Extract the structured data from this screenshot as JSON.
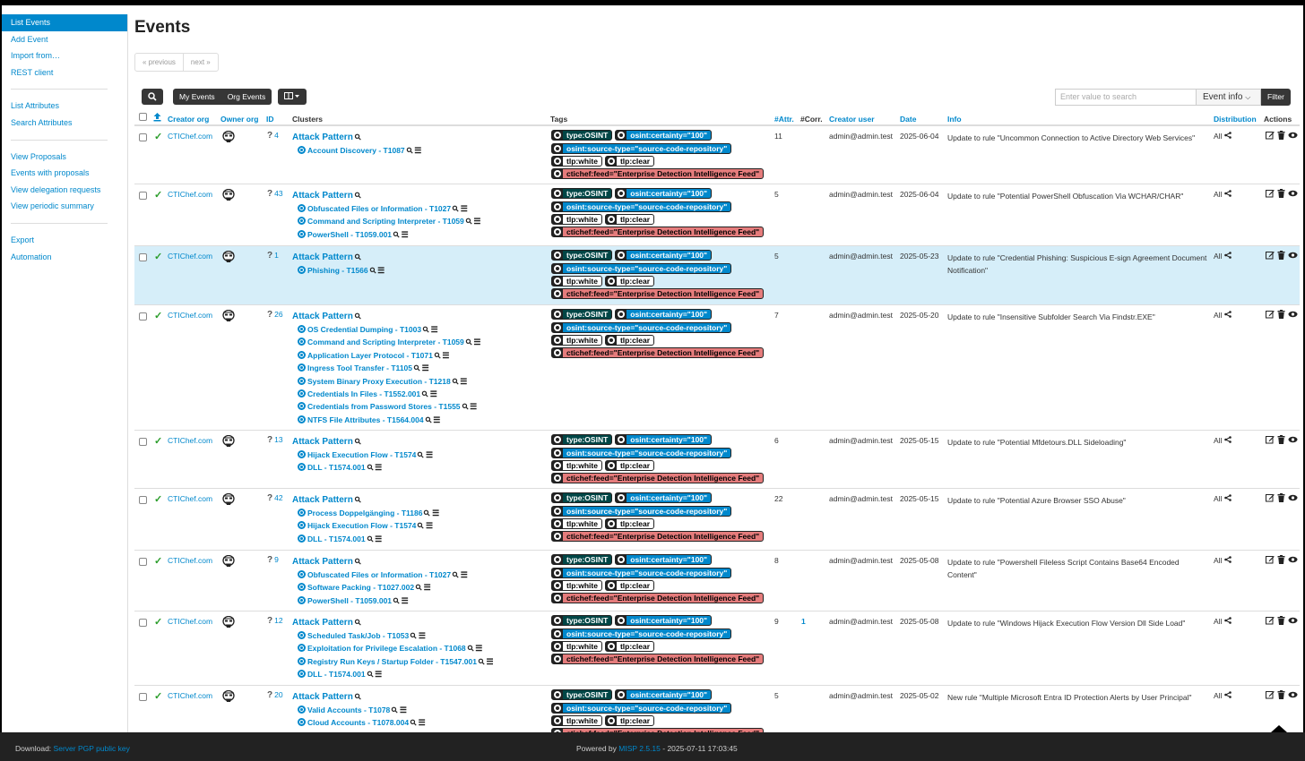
{
  "sidebar": {
    "groups": [
      [
        "List Events",
        "Add Event",
        "Import from…",
        "REST client"
      ],
      [
        "List Attributes",
        "Search Attributes"
      ],
      [
        "View Proposals",
        "Events with proposals",
        "View delegation requests",
        "View periodic summary"
      ],
      [
        "Export",
        "Automation"
      ]
    ]
  },
  "page": {
    "title": "Events",
    "pager_prev": "« previous",
    "pager_next": "next »"
  },
  "toolbar": {
    "my_events": "My Events",
    "org_events": "Org Events",
    "search_placeholder": "Enter value to search",
    "search_field": "Event info",
    "filter": "Filter"
  },
  "columns": {
    "creator_org": "Creator org",
    "owner_org": "Owner org",
    "id": "ID",
    "clusters": "Clusters",
    "tags": "Tags",
    "attr": "#Attr.",
    "corr": "#Corr.",
    "creator_user": "Creator user",
    "date": "Date",
    "info": "Info",
    "distribution": "Distribution",
    "actions": "Actions"
  },
  "tags": {
    "osint": "type:OSINT",
    "certainty": "osint:certainty=\"100\"",
    "source": "osint:source-type=\"source-code-repository\"",
    "white": "tlp:white",
    "clear": "tlp:clear",
    "feed": "ctichef:feed=\"Enterprise Detection Intelligence Feed\""
  },
  "events": [
    {
      "org": "CTIChef.com",
      "id": "4",
      "cluster_head": "Attack Pattern",
      "clusters": [
        "Account Discovery - T1087"
      ],
      "attr": "11",
      "corr": "",
      "user": "admin@admin.test",
      "date": "2025-06-04",
      "info": "Update to rule \"Uncommon Connection to Active Directory Web Services\"",
      "dist": "All"
    },
    {
      "org": "CTIChef.com",
      "id": "43",
      "cluster_head": "Attack Pattern",
      "clusters": [
        "Obfuscated Files or Information - T1027",
        "Command and Scripting Interpreter - T1059",
        "PowerShell - T1059.001"
      ],
      "attr": "5",
      "corr": "",
      "user": "admin@admin.test",
      "date": "2025-06-04",
      "info": "Update to rule \"Potential PowerShell Obfuscation Via WCHAR/CHAR\"",
      "dist": "All"
    },
    {
      "org": "CTIChef.com",
      "id": "1",
      "cluster_head": "Attack Pattern",
      "clusters": [
        "Phishing - T1566"
      ],
      "attr": "5",
      "corr": "",
      "user": "admin@admin.test",
      "date": "2025-05-23",
      "info": "Update to rule \"Credential Phishing: Suspicious E-sign Agreement Document Notification\"",
      "dist": "All"
    },
    {
      "org": "CTIChef.com",
      "id": "26",
      "cluster_head": "Attack Pattern",
      "clusters": [
        "OS Credential Dumping - T1003",
        "Command and Scripting Interpreter - T1059",
        "Application Layer Protocol - T1071",
        "Ingress Tool Transfer - T1105",
        "System Binary Proxy Execution - T1218",
        "Credentials In Files - T1552.001",
        "Credentials from Password Stores - T1555",
        "NTFS File Attributes - T1564.004"
      ],
      "attr": "7",
      "corr": "",
      "user": "admin@admin.test",
      "date": "2025-05-20",
      "info": "Update to rule \"Insensitive Subfolder Search Via Findstr.EXE\"",
      "dist": "All"
    },
    {
      "org": "CTIChef.com",
      "id": "13",
      "cluster_head": "Attack Pattern",
      "clusters": [
        "Hijack Execution Flow - T1574",
        "DLL - T1574.001"
      ],
      "attr": "6",
      "corr": "",
      "user": "admin@admin.test",
      "date": "2025-05-15",
      "info": "Update to rule \"Potential Mfdetours.DLL Sideloading\"",
      "dist": "All"
    },
    {
      "org": "CTIChef.com",
      "id": "42",
      "cluster_head": "Attack Pattern",
      "clusters": [
        "Process Doppelgänging - T1186",
        "Hijack Execution Flow - T1574",
        "DLL - T1574.001"
      ],
      "attr": "22",
      "corr": "",
      "user": "admin@admin.test",
      "date": "2025-05-15",
      "info": "Update to rule \"Potential Azure Browser SSO Abuse\"",
      "dist": "All"
    },
    {
      "org": "CTIChef.com",
      "id": "9",
      "cluster_head": "Attack Pattern",
      "clusters": [
        "Obfuscated Files or Information - T1027",
        "Software Packing - T1027.002",
        "PowerShell - T1059.001"
      ],
      "attr": "8",
      "corr": "",
      "user": "admin@admin.test",
      "date": "2025-05-08",
      "info": "Update to rule \"Powershell Fileless Script Contains Base64 Encoded Content\"",
      "dist": "All"
    },
    {
      "org": "CTIChef.com",
      "id": "12",
      "cluster_head": "Attack Pattern",
      "clusters": [
        "Scheduled Task/Job - T1053",
        "Exploitation for Privilege Escalation - T1068",
        "Registry Run Keys / Startup Folder - T1547.001",
        "DLL - T1574.001"
      ],
      "attr": "9",
      "corr": "1",
      "user": "admin@admin.test",
      "date": "2025-05-08",
      "info": "Update to rule \"Windows Hijack Execution Flow Version Dll Side Load\"",
      "dist": "All"
    },
    {
      "org": "CTIChef.com",
      "id": "20",
      "cluster_head": "Attack Pattern",
      "clusters": [
        "Valid Accounts - T1078",
        "Cloud Accounts - T1078.004"
      ],
      "attr": "5",
      "corr": "",
      "user": "admin@admin.test",
      "date": "2025-05-02",
      "info": "New rule \"Multiple Microsoft Entra ID Protection Alerts by User Principal\"",
      "dist": "All"
    }
  ],
  "footer": {
    "download_label": "Download:",
    "download_link": "Server PGP public key",
    "powered_by": "Powered by",
    "misp_version": "MISP 2.5.15",
    "timestamp": "- 2025-07-11 17:03:45"
  },
  "icons": {
    "check": "check-icon",
    "owner": "stormtrooper-icon",
    "globe": "globe-icon",
    "search": "search-icon",
    "list": "list-icon",
    "share": "share-icon",
    "edit": "edit-icon",
    "trash": "trash-icon",
    "eye": "eye-icon"
  }
}
